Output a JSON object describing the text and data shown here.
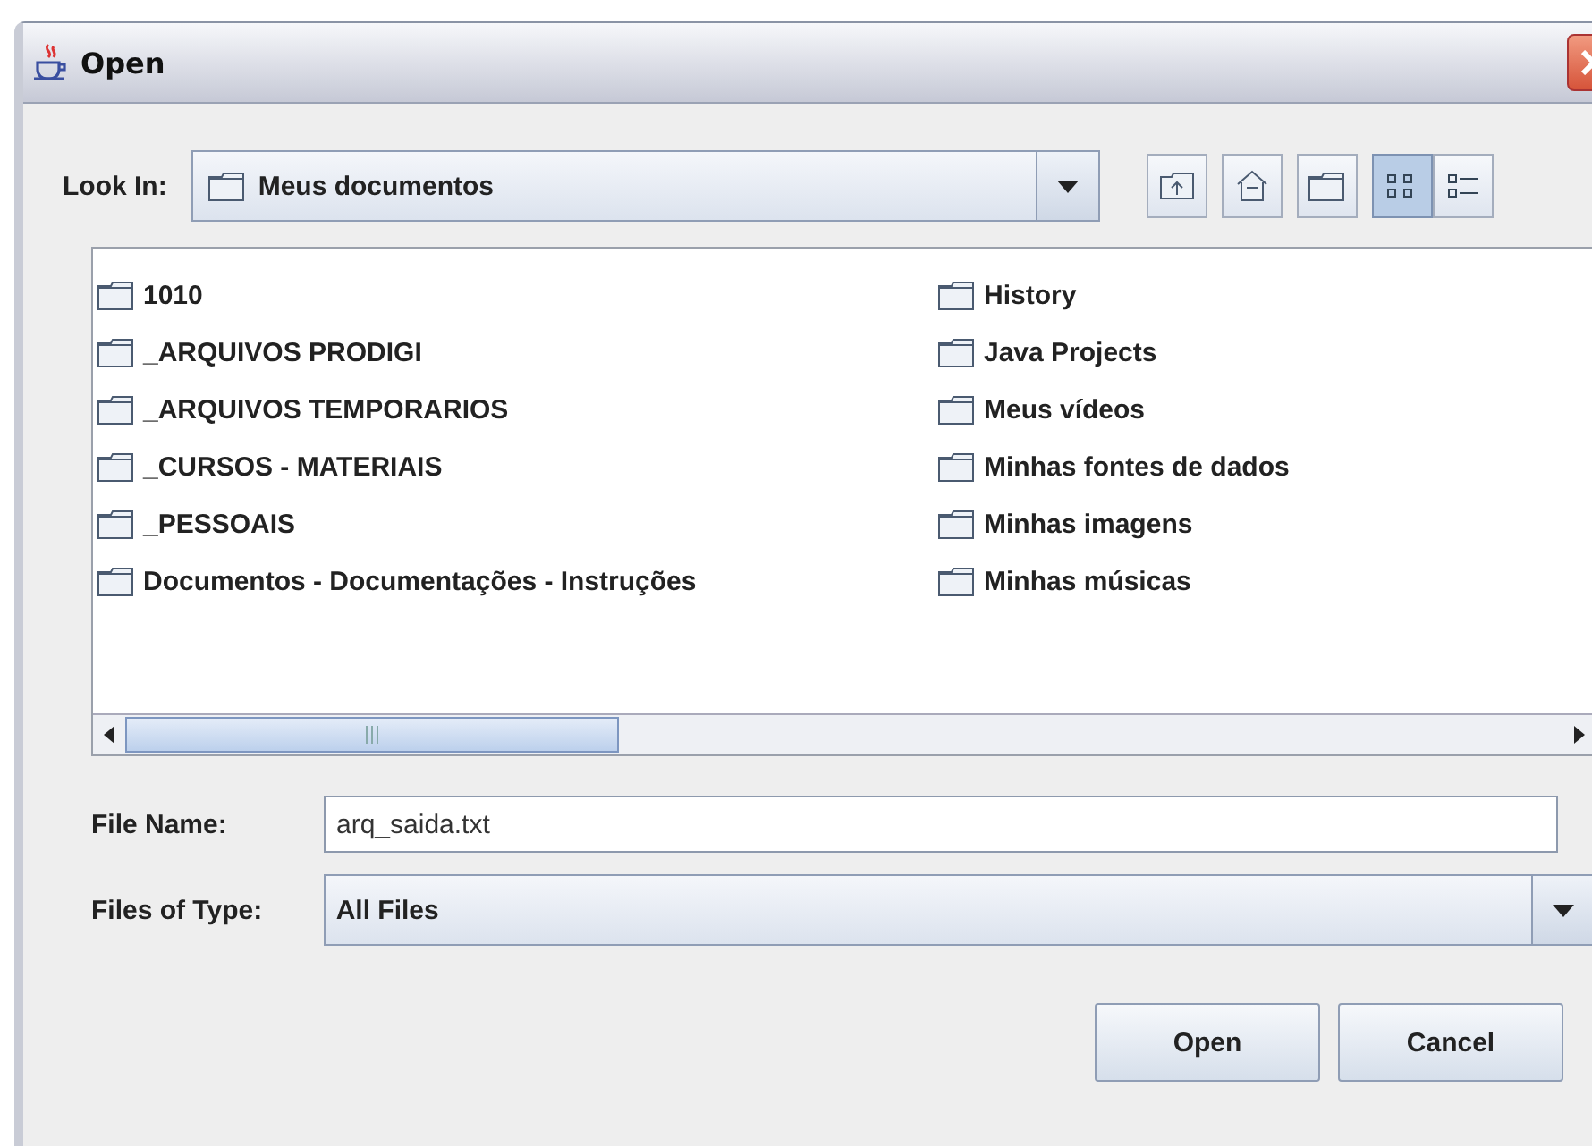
{
  "window": {
    "title": "Open"
  },
  "look_in": {
    "label": "Look In:",
    "value": "Meus documentos"
  },
  "view_buttons": [
    {
      "selected": true
    },
    {
      "selected": false
    }
  ],
  "files": [
    {
      "name": "1010"
    },
    {
      "name": "_ARQUIVOS PRODIGI"
    },
    {
      "name": "_ARQUIVOS TEMPORARIOS"
    },
    {
      "name": "_CURSOS - MATERIAIS"
    },
    {
      "name": "_PESSOAIS"
    },
    {
      "name": "Documentos - Documentações - Instruções"
    },
    {
      "name": "History"
    },
    {
      "name": "Java Projects"
    },
    {
      "name": "Meus vídeos"
    },
    {
      "name": "Minhas fontes de dados"
    },
    {
      "name": "Minhas imagens"
    },
    {
      "name": "Minhas músicas"
    }
  ],
  "file_name": {
    "label": "File Name:",
    "value": "arq_saida.txt"
  },
  "file_type": {
    "label": "Files of Type:",
    "value": "All Files"
  },
  "buttons": [
    "Open",
    "Cancel"
  ]
}
